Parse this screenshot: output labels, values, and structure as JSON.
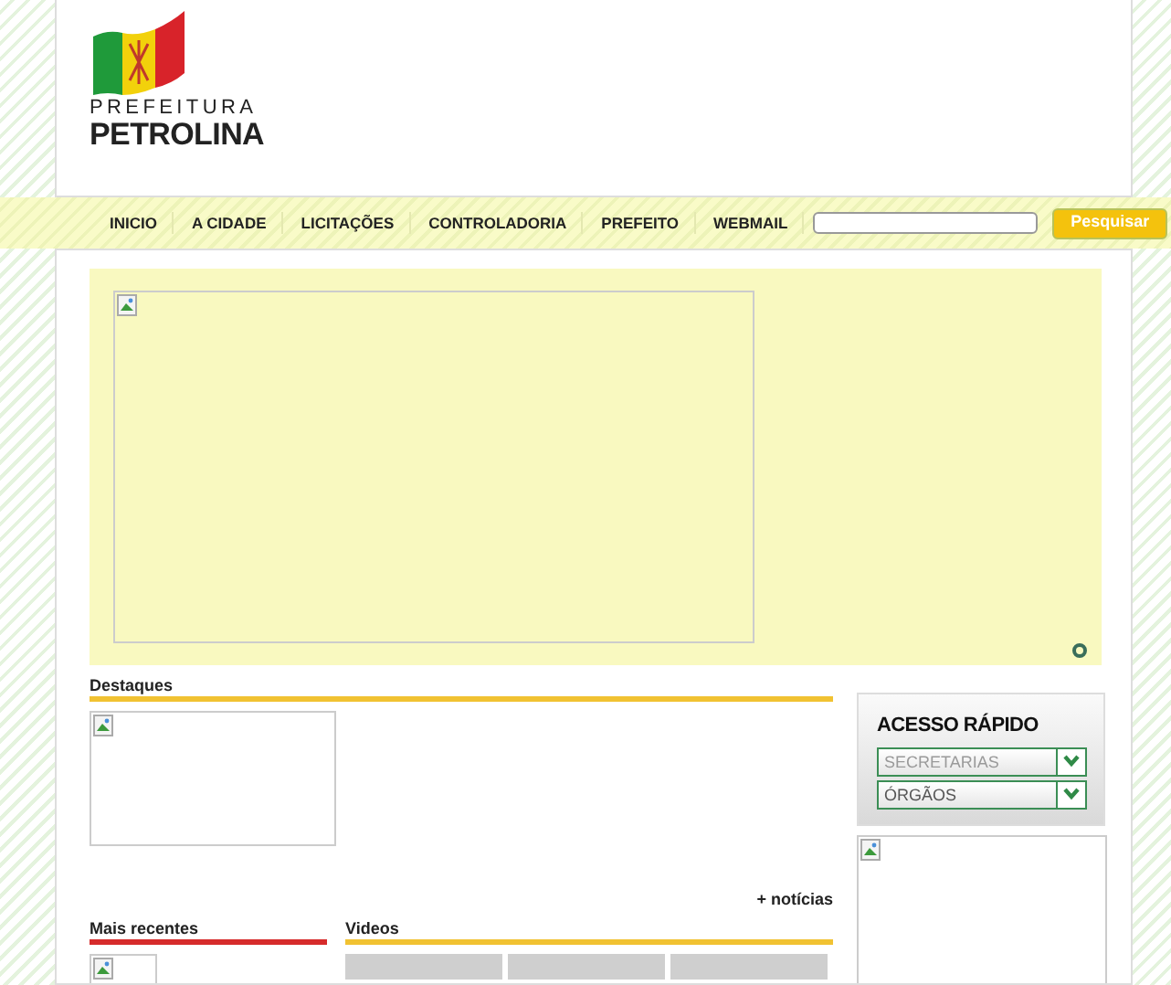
{
  "logo": {
    "line_1": "PREFEITURA",
    "line_2": "PETROLINA"
  },
  "nav": {
    "items": [
      "INICIO",
      "A CIDADE",
      "LICITAÇÕES",
      "CONTROLADORIA",
      "PREFEITO",
      "WEBMAIL"
    ],
    "search_button": "Pesquisar"
  },
  "destaques": {
    "title": "Destaques",
    "more_link": "+ notícias"
  },
  "mais_recentes": {
    "title": "Mais recentes"
  },
  "videos": {
    "title": "Videos",
    "thumbnails": [
      {
        "kind": "video"
      },
      {
        "kind": "video"
      },
      {
        "kind": "video"
      }
    ]
  },
  "acesso_rapido": {
    "title": "ACESSO RÁPIDO",
    "selects": [
      {
        "text": "SECRETARIAS",
        "kind": "placeholder"
      },
      {
        "text": "ÓRGÃOS",
        "kind": "value"
      }
    ]
  }
}
